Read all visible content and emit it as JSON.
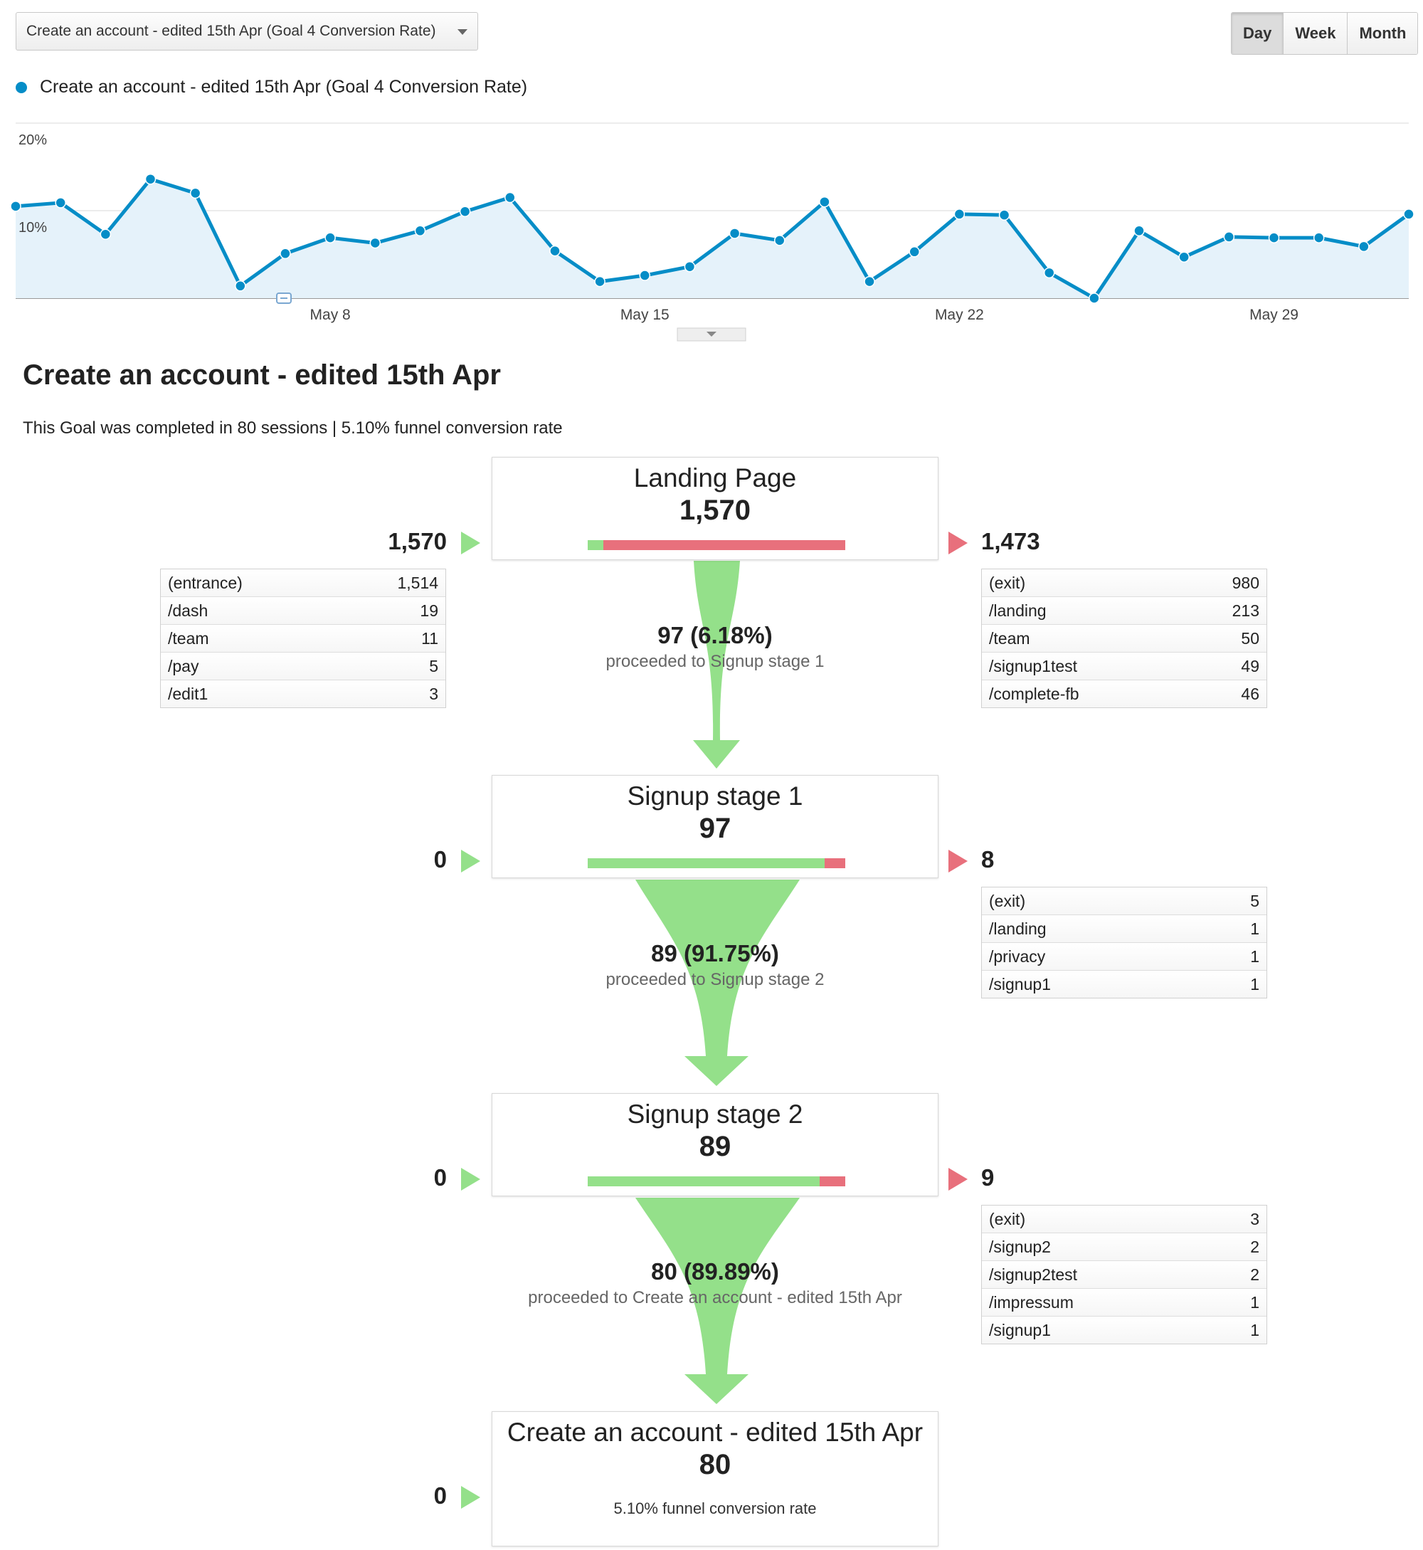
{
  "controls": {
    "goal_select": "Create an account - edited 15th Apr (Goal 4 Conversion Rate)",
    "periods": [
      "Day",
      "Week",
      "Month"
    ],
    "active_period": "Day"
  },
  "chart": {
    "legend": "Create an account - edited 15th Apr (Goal 4 Conversion Rate)",
    "color": "#058dc7"
  },
  "chart_data": {
    "type": "area",
    "series": [
      {
        "name": "Create an account - edited 15th Apr (Goal 4 Conversion Rate)",
        "values": [
          10.5,
          10.9,
          7.3,
          13.6,
          12.0,
          1.4,
          5.1,
          6.9,
          6.3,
          7.7,
          9.9,
          11.5,
          5.4,
          1.9,
          2.6,
          3.6,
          7.4,
          6.6,
          11.0,
          1.9,
          5.3,
          9.6,
          9.5,
          2.9,
          0.0,
          7.7,
          4.7,
          7.0,
          6.9,
          6.9,
          5.9,
          9.6
        ]
      }
    ],
    "x_labels": [
      "May 8",
      "May 15",
      "May 22",
      "May 29"
    ],
    "y_ticks": [
      "20%",
      "10%"
    ],
    "ylim": [
      0,
      20
    ],
    "grid": true
  },
  "funnel": {
    "title": "Create an account - edited 15th Apr",
    "summary": "This Goal was completed in 80 sessions | 5.10% funnel conversion rate",
    "stages": [
      {
        "name": "Landing Page",
        "value": "1,570",
        "entry": "1,570",
        "exit": "1,473",
        "progress": 0.06
      },
      {
        "name": "Signup stage 1",
        "value": "97",
        "entry": "0",
        "exit": "8",
        "progress": 0.92
      },
      {
        "name": "Signup stage 2",
        "value": "89",
        "entry": "0",
        "exit": "9",
        "progress": 0.9
      },
      {
        "name": "Create an account - edited 15th Apr",
        "value": "80",
        "entry": "0",
        "note": "5.10% funnel conversion rate"
      }
    ],
    "transitions": [
      {
        "count": "97 (6.18%)",
        "label": "proceeded to Signup stage 1"
      },
      {
        "count": "89 (91.75%)",
        "label": "proceeded to Signup stage 2"
      },
      {
        "count": "80 (89.89%)",
        "label": "proceeded to Create an account - edited 15th Apr"
      }
    ],
    "entrances": [
      [
        [
          "(entrance)",
          "1,514"
        ],
        [
          "/dash",
          "19"
        ],
        [
          "/team",
          "11"
        ],
        [
          "/pay",
          "5"
        ],
        [
          "/edit1",
          "3"
        ]
      ]
    ],
    "exits": [
      [
        [
          "(exit)",
          "980"
        ],
        [
          "/landing",
          "213"
        ],
        [
          "/team",
          "50"
        ],
        [
          "/signup1test",
          "49"
        ],
        [
          "/complete-fb",
          "46"
        ]
      ],
      [
        [
          "(exit)",
          "5"
        ],
        [
          "/landing",
          "1"
        ],
        [
          "/privacy",
          "1"
        ],
        [
          "/signup1",
          "1"
        ]
      ],
      [
        [
          "(exit)",
          "3"
        ],
        [
          "/signup2",
          "2"
        ],
        [
          "/signup2test",
          "2"
        ],
        [
          "/impressum",
          "1"
        ],
        [
          "/signup1",
          "1"
        ]
      ]
    ]
  }
}
